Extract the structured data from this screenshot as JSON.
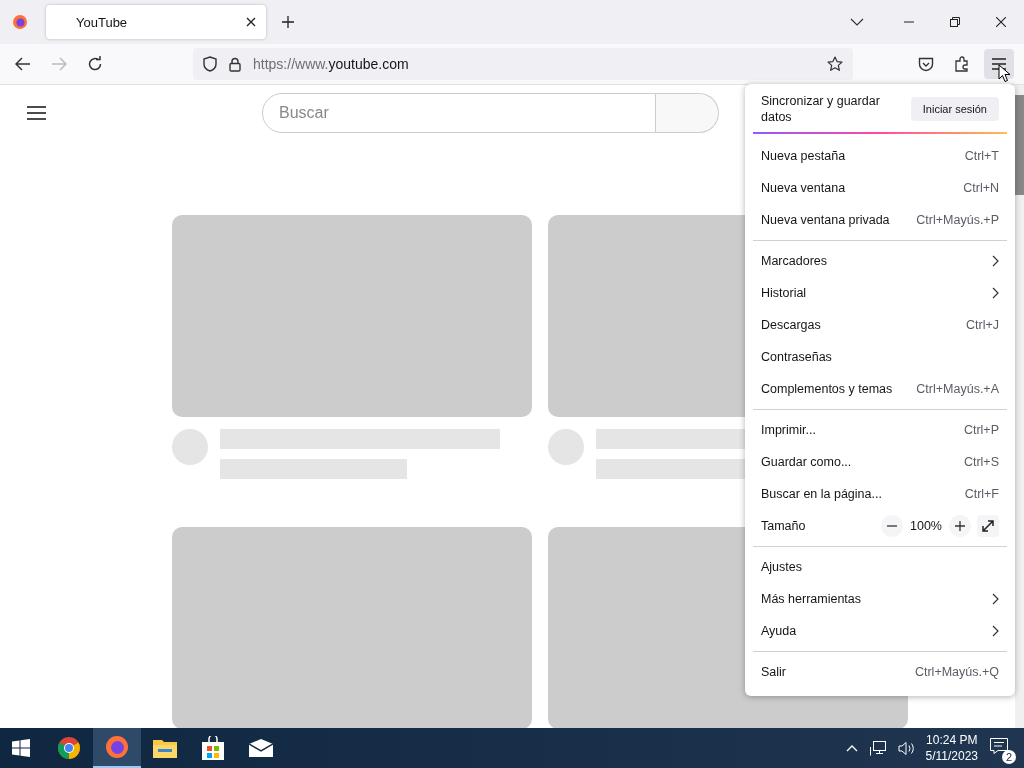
{
  "browser": {
    "tabs": [
      {
        "title": "YouTube",
        "selected": true
      }
    ],
    "url_prefix": "https://www.",
    "url_host": "youtube.com"
  },
  "page": {
    "search": {
      "placeholder": "Buscar"
    }
  },
  "menu": {
    "sync_label": "Sincronizar y guardar datos",
    "sign_in": "Iniciar sesión",
    "sections": [
      [
        {
          "kind": "item",
          "label": "Nueva pestaña",
          "shortcut": "Ctrl+T",
          "submenu": false
        },
        {
          "kind": "item",
          "label": "Nueva ventana",
          "shortcut": "Ctrl+N",
          "submenu": false
        },
        {
          "kind": "item",
          "label": "Nueva ventana privada",
          "shortcut": "Ctrl+Mayús.+P",
          "submenu": false
        }
      ],
      [
        {
          "kind": "item",
          "label": "Marcadores",
          "submenu": true
        },
        {
          "kind": "item",
          "label": "Historial",
          "submenu": true
        },
        {
          "kind": "item",
          "label": "Descargas",
          "shortcut": "Ctrl+J",
          "submenu": false
        },
        {
          "kind": "item",
          "label": "Contraseñas",
          "submenu": false
        },
        {
          "kind": "item",
          "label": "Complementos y temas",
          "shortcut": "Ctrl+Mayús.+A",
          "submenu": false
        }
      ],
      [
        {
          "kind": "item",
          "label": "Imprimir...",
          "shortcut": "Ctrl+P",
          "submenu": false
        },
        {
          "kind": "item",
          "label": "Guardar como...",
          "shortcut": "Ctrl+S",
          "submenu": false
        },
        {
          "kind": "item",
          "label": "Buscar en la página...",
          "shortcut": "Ctrl+F",
          "submenu": false
        },
        {
          "kind": "zoom",
          "label": "Tamaño",
          "value": "100%"
        }
      ],
      [
        {
          "kind": "item",
          "label": "Ajustes",
          "submenu": false
        },
        {
          "kind": "item",
          "label": "Más herramientas",
          "submenu": true
        },
        {
          "kind": "item",
          "label": "Ayuda",
          "submenu": true
        }
      ],
      [
        {
          "kind": "item",
          "label": "Salir",
          "shortcut": "Ctrl+Mayús.+Q",
          "submenu": false
        }
      ]
    ]
  },
  "taskbar": {
    "apps": [
      {
        "kind": "chrome",
        "selected": false
      },
      {
        "kind": "firefox",
        "selected": true
      },
      {
        "kind": "folder",
        "selected": false
      },
      {
        "kind": "store",
        "selected": false
      },
      {
        "kind": "mail",
        "selected": false
      }
    ],
    "time": "10:24 PM",
    "date": "5/11/2023",
    "notifications": "2"
  }
}
